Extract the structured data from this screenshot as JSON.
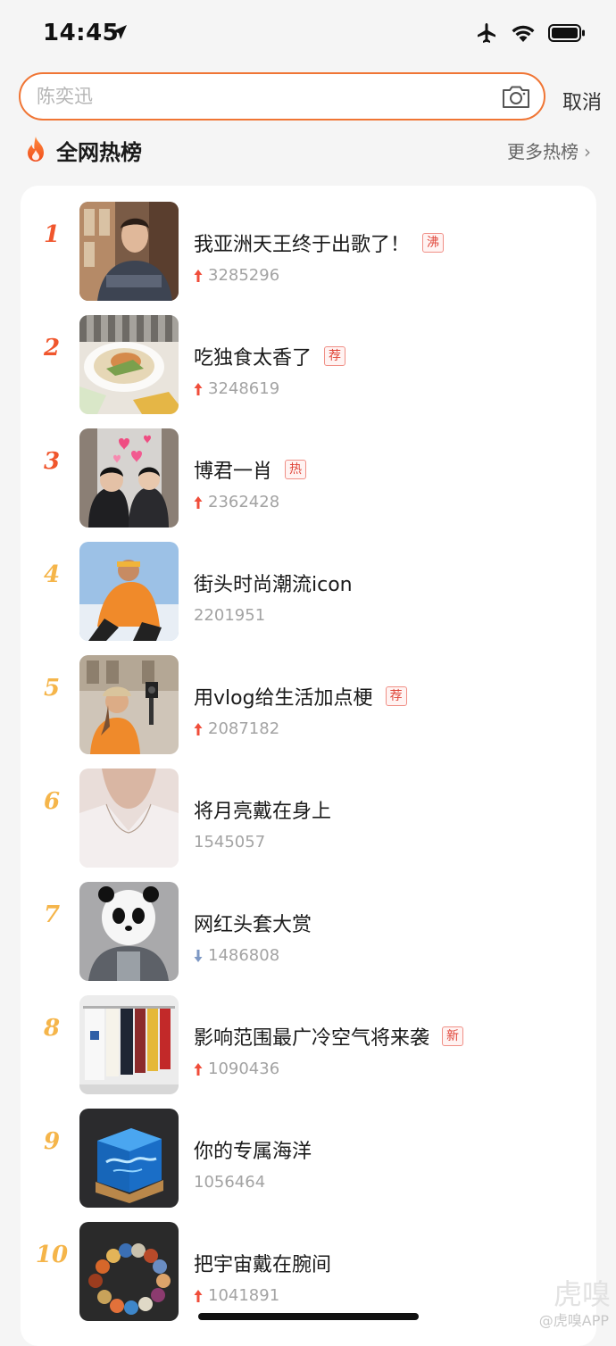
{
  "status_bar": {
    "time": "14:45",
    "icons": [
      "location-arrow-icon",
      "airplane-icon",
      "wifi-icon",
      "battery-icon"
    ]
  },
  "search": {
    "placeholder": "陈奕迅",
    "cancel_label": "取消",
    "camera_icon": "camera-icon",
    "accent_color": "#f07534"
  },
  "hot_list": {
    "title": "全网热榜",
    "more_label": "更多热榜",
    "rank_colors": {
      "top3": "#f0562d",
      "rest": "#f5b54a"
    },
    "items": [
      {
        "rank": "1",
        "title": "我亚洲天王终于出歌了！",
        "tag": "沸",
        "count": "3285296",
        "trend": "up"
      },
      {
        "rank": "2",
        "title": "吃独食太香了",
        "tag": "荐",
        "count": "3248619",
        "trend": "up"
      },
      {
        "rank": "3",
        "title": "博君一肖",
        "tag": "热",
        "count": "2362428",
        "trend": "up"
      },
      {
        "rank": "4",
        "title": "街头时尚潮流icon",
        "tag": "",
        "count": "2201951",
        "trend": "none"
      },
      {
        "rank": "5",
        "title": "用vlog给生活加点梗",
        "tag": "荐",
        "count": "2087182",
        "trend": "up"
      },
      {
        "rank": "6",
        "title": "将月亮戴在身上",
        "tag": "",
        "count": "1545057",
        "trend": "none"
      },
      {
        "rank": "7",
        "title": "网红头套大赏",
        "tag": "",
        "count": "1486808",
        "trend": "down"
      },
      {
        "rank": "8",
        "title": "影响范围最广冷空气将来袭",
        "tag": "新",
        "count": "1090436",
        "trend": "up"
      },
      {
        "rank": "9",
        "title": "你的专属海洋",
        "tag": "",
        "count": "1056464",
        "trend": "none"
      },
      {
        "rank": "10",
        "title": "把宇宙戴在腕间",
        "tag": "",
        "count": "1041891",
        "trend": "up"
      }
    ]
  },
  "watermark": {
    "logo_text": "虎嗅",
    "text": "@虎嗅APP"
  }
}
